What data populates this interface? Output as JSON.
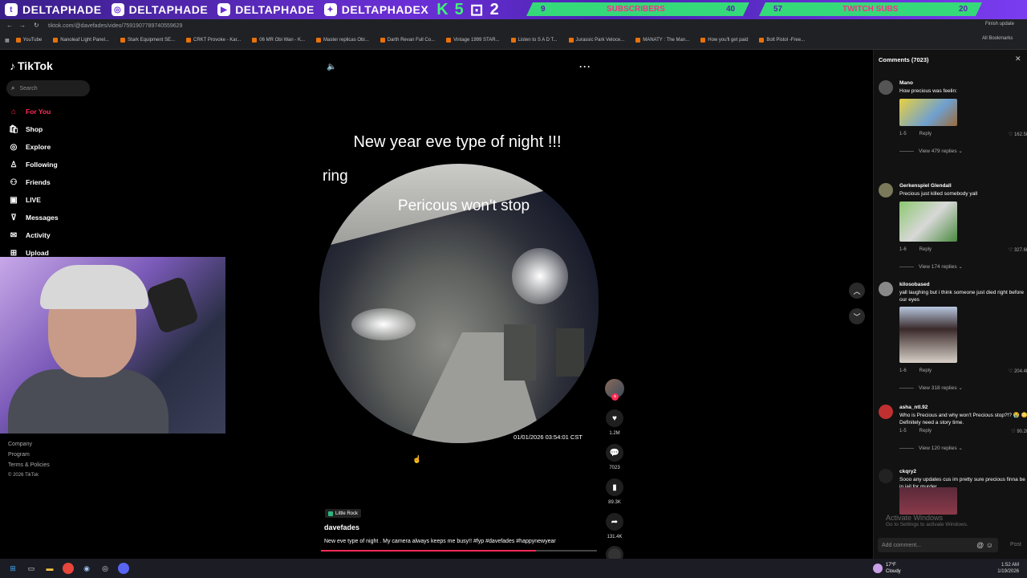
{
  "overlay": {
    "handles": [
      "DELTAPHADE",
      "DELTAPHADE",
      "DELTAPHADE",
      "DELTAPHADEX"
    ],
    "icons": [
      "twitch-icon",
      "instagram-icon",
      "youtube-icon",
      "twitter-icon"
    ],
    "k_count": "5",
    "twitch_count": "2",
    "subs_label": "SUBSCRIBERS",
    "subs_current": "9",
    "subs_goal": "40",
    "subs_progress": 0.225,
    "twitch_subs_label": "TWITCH SUBS",
    "twitch_subs_current": "57",
    "twitch_subs_goal": "20"
  },
  "browser": {
    "url": "tiktok.com/@davefades/video/7591907789740559629",
    "bookmarks": [
      "YouTube",
      "Nanoleaf Light Panel...",
      "Stark Equipment SE...",
      "CRKT Provoke - Kar...",
      "06 MR Obi Wan - K...",
      "Master replicas Obi...",
      "Darth Revan Full Co...",
      "Vintage 1999 STAR...",
      "Listen to S A D T...",
      "Jurassic Park Veloce...",
      "MANATY : The Man...",
      "How you'll get paid",
      "Bolt Pistol -Free..."
    ],
    "all_bookmarks": "All Bookmarks",
    "finish_update": "Finish update"
  },
  "sidebar": {
    "logo": "TikTok",
    "search_placeholder": "Search",
    "nav": [
      {
        "label": "For You",
        "icon": "home-icon"
      },
      {
        "label": "Shop",
        "icon": "shop-icon"
      },
      {
        "label": "Explore",
        "icon": "compass-icon"
      },
      {
        "label": "Following",
        "icon": "following-icon"
      },
      {
        "label": "Friends",
        "icon": "friends-icon"
      },
      {
        "label": "LIVE",
        "icon": "live-icon"
      },
      {
        "label": "Messages",
        "icon": "messages-icon"
      },
      {
        "label": "Activity",
        "icon": "activity-icon"
      },
      {
        "label": "Upload",
        "icon": "upload-icon"
      }
    ],
    "footer": [
      "Company",
      "Program",
      "Terms & Policies",
      "© 2026 TikTok"
    ]
  },
  "video": {
    "title": "New year eve type of night !!!",
    "ring_label": "ring",
    "caption": "Pericous won't stop",
    "timestamp": "01/01/2026 03:54:01 CST",
    "location": "Little Rock",
    "username": "davefades",
    "description": "New eve type of night . My camera always keeps me busy!! #fyp #davefades #happynewyear",
    "progress": 0.78
  },
  "actions": {
    "likes": "1.2M",
    "comments": "7023",
    "saves": "89.3K",
    "shares": "131.4K"
  },
  "comments": {
    "header": "Comments (7023)",
    "reply_label": "Reply",
    "add_placeholder": "Add comment...",
    "post_label": "Post",
    "items": [
      {
        "user": "Mano",
        "text": "How precious was feelin:",
        "date": "1-5",
        "likes": "162.5K",
        "replies": "View 479 replies"
      },
      {
        "user": "Gerkenspiel Glendall",
        "text": "Precious just killed somebody yall",
        "date": "1-6",
        "likes": "327.6K",
        "replies": "View 174 replies"
      },
      {
        "user": "kilosobased",
        "text": "yall laughing but i think someone just died right before our eyes",
        "date": "1-6",
        "likes": "204.4K",
        "replies": "View 318 replies"
      },
      {
        "user": "asha_ntl.92",
        "text": "Who is Precious and why won't Precious stop?!? 😭 😳 Definitely need a story time.",
        "date": "1-5",
        "likes": "90.2K",
        "replies": "View 120 replies"
      },
      {
        "user": "ckqry2",
        "text": "Sooo any updates cus im pretty sure precious finna be in jail for murder",
        "date": "",
        "likes": "",
        "replies": ""
      }
    ]
  },
  "watermark": {
    "line1": "Activate Windows",
    "line2": "Go to Settings to activate Windows."
  },
  "taskbar": {
    "weather_temp": "17°F",
    "weather_desc": "Cloudy",
    "time": "1:52 AM",
    "date": "1/19/2026"
  }
}
